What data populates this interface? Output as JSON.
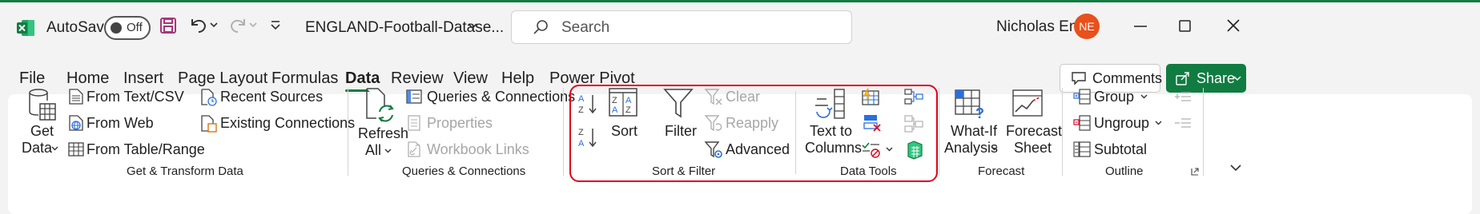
{
  "titlebar": {
    "autosave_label": "AutoSave",
    "autosave_state": "Off",
    "filename": "ENGLAND-Football-Datase...",
    "search_placeholder": "Search",
    "user_name": "Nicholas End",
    "user_initials": "NE"
  },
  "tabs": [
    "File",
    "Home",
    "Insert",
    "Page Layout",
    "Formulas",
    "Data",
    "Review",
    "View",
    "Help",
    "Power Pivot"
  ],
  "active_tab": "Data",
  "actions": {
    "comments": "Comments",
    "share": "Share"
  },
  "groups": {
    "get_transform": {
      "label": "Get & Transform Data",
      "get_data": [
        "Get",
        "Data"
      ],
      "from_text_csv": "From Text/CSV",
      "from_web": "From Web",
      "from_table_range": "From Table/Range",
      "recent_sources": "Recent Sources",
      "existing_connections": "Existing Connections"
    },
    "queries": {
      "label": "Queries & Connections",
      "refresh_all": [
        "Refresh",
        "All"
      ],
      "queries_connections": "Queries & Connections",
      "properties": "Properties",
      "workbook_links": "Workbook Links"
    },
    "sort_filter": {
      "label": "Sort & Filter",
      "sort": "Sort",
      "filter": "Filter",
      "clear": "Clear",
      "reapply": "Reapply",
      "advanced": "Advanced"
    },
    "data_tools": {
      "label": "Data Tools",
      "text_to_columns": [
        "Text to",
        "Columns"
      ]
    },
    "forecast": {
      "label": "Forecast",
      "what_if": [
        "What-If",
        "Analysis"
      ],
      "forecast_sheet": [
        "Forecast",
        "Sheet"
      ]
    },
    "outline": {
      "label": "Outline",
      "group": "Group",
      "ungroup": "Ungroup",
      "subtotal": "Subtotal"
    }
  },
  "colors": {
    "excel_green": "#107c41",
    "avatar": "#e8501c",
    "highlight": "#e0001b",
    "save_icon": "#a5367a"
  }
}
